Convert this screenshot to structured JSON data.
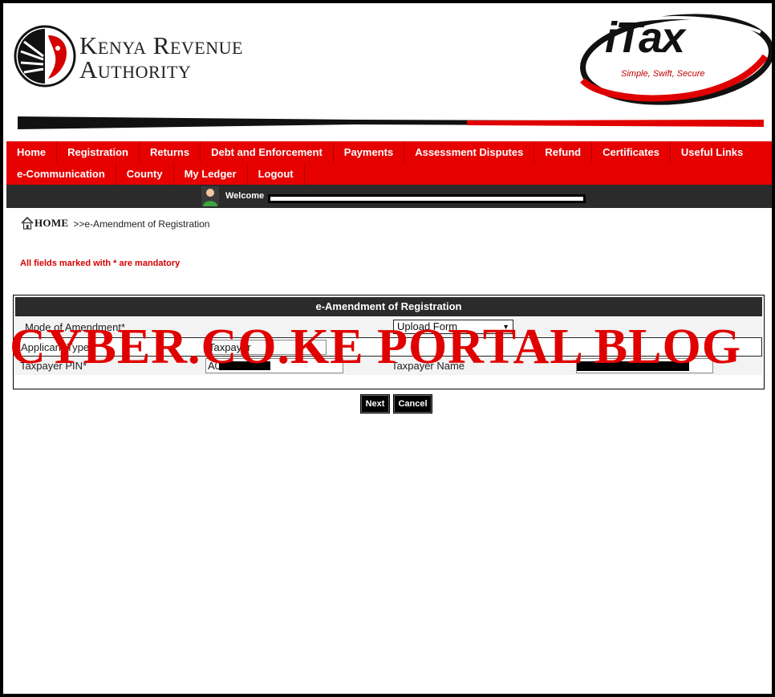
{
  "header": {
    "org_name_line1": "Kenya Revenue",
    "org_name_line2": "Authority",
    "itax_logo_text": "iTax",
    "itax_tagline": "Simple, Swift, Secure"
  },
  "nav": {
    "row1": [
      "Home",
      "Registration",
      "Returns",
      "Debt and Enforcement",
      "Payments",
      "Assessment Disputes",
      "Refund",
      "Certificates",
      "Useful Links"
    ],
    "row2": [
      "e-Communication",
      "County",
      "My Ledger",
      "Logout"
    ]
  },
  "welcome": {
    "label": "Welcome"
  },
  "breadcrumb": {
    "home": "HOME",
    "separator": ">>",
    "current": "e-Amendment of Registration"
  },
  "mandatory_note": "All fields marked with * are mandatory",
  "form": {
    "title": "e-Amendment of Registration",
    "mode_label": "Mode of Amendment*",
    "mode_value": "Upload Form",
    "applicant_label": "Applicant Type*",
    "applicant_value": "Taxpayer",
    "pin_label": "Taxpayer PIN*",
    "pin_value": "A0",
    "name_label": "Taxpayer Name"
  },
  "buttons": {
    "next": "Next",
    "cancel": "Cancel"
  },
  "watermark": "CYBER.CO.KE PORTAL BLOG",
  "colors": {
    "brand_red": "#e60000",
    "dark_bar": "#2b2b2b",
    "mandatory_red": "#d40000"
  }
}
